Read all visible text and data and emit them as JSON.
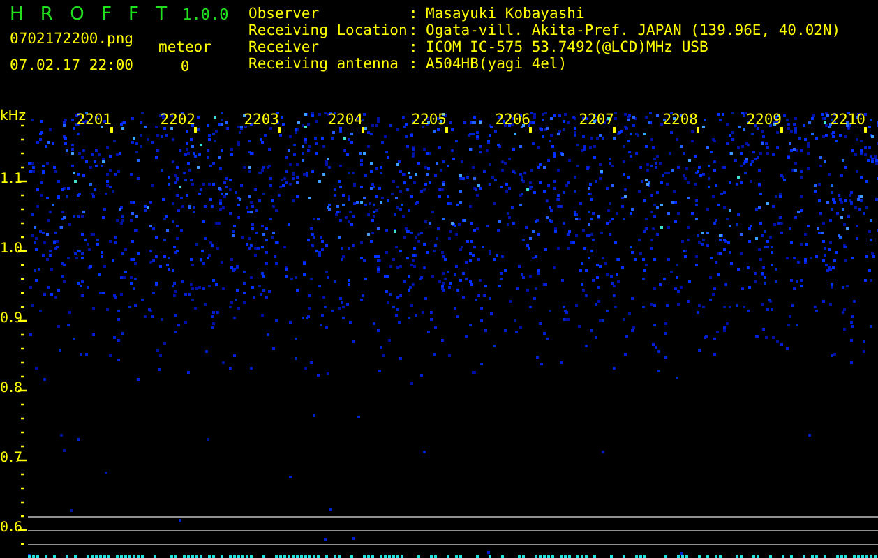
{
  "app": {
    "title": "H R O F F T",
    "version": "1.0.0"
  },
  "file": "0702172200.png",
  "timestamp": "07.02.17 22:00",
  "meteor": {
    "label": "meteor",
    "count": "0"
  },
  "info": [
    {
      "label": "Observer",
      "separator": ":",
      "value": "Masayuki Kobayashi"
    },
    {
      "label": "Receiving Location",
      "separator": ":",
      "value": "Ogata-vill. Akita-Pref. JAPAN (139.96E, 40.02N)"
    },
    {
      "label": "Receiver",
      "separator": ":",
      "value": "ICOM IC-575 53.7492(@LCD)MHz USB"
    },
    {
      "label": "Receiving antenna",
      "separator": ":",
      "value": "A504HB(yagi 4el)"
    }
  ],
  "spectrogram": {
    "frequency_unit": "kHz",
    "frequency_labels": [
      "1.1",
      "1.0",
      "0.9",
      "0.8",
      "0.7",
      "0.6"
    ],
    "time_labels": [
      "2201",
      "2202",
      "2203",
      "2204",
      "2205",
      "2206",
      "2207",
      "2208",
      "2209",
      "2210"
    ]
  }
}
